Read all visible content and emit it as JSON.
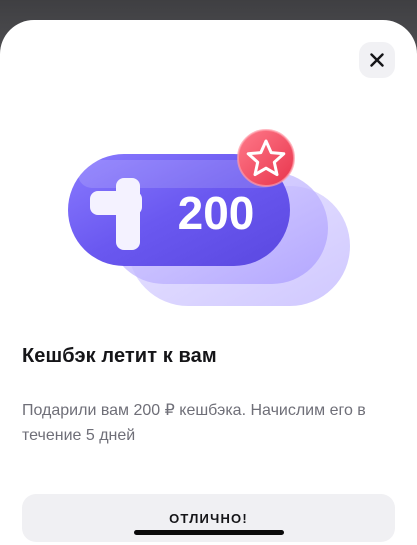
{
  "dialog": {
    "close_label": "close",
    "illustration": {
      "amount_text": "200",
      "plus_symbol": "+",
      "badge_icon": "star-icon",
      "colors": {
        "pill_main": "#6c5cf2",
        "pill_back": "#b8acff",
        "badge": "#f2455b"
      }
    },
    "title": "Кешбэк летит к вам",
    "description": "Подарили вам 200 ₽ кешбэка. Начислим его в течение 5 дней",
    "button_label": "ОТЛИЧНО!"
  }
}
